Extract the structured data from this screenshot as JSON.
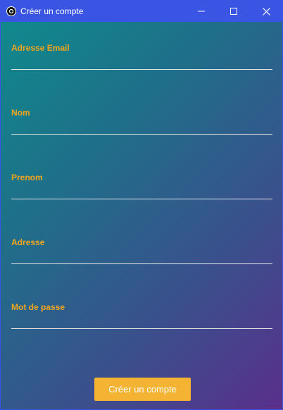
{
  "window": {
    "title": "Créer un compte",
    "app_icon": "circle-logo-icon",
    "controls": [
      "minimize-icon",
      "maximize-icon",
      "close-icon"
    ],
    "accent": "#3a55e4"
  },
  "form": {
    "fields": [
      {
        "label": "Adresse Email",
        "value": ""
      },
      {
        "label": "Nom",
        "value": ""
      },
      {
        "label": "Prenom",
        "value": ""
      },
      {
        "label": "Adresse",
        "value": ""
      },
      {
        "label": "Mot de passe",
        "value": ""
      }
    ],
    "label_color": "#f2a51c",
    "submit_label": "Créer un compte",
    "submit_color": "#f4b332"
  }
}
